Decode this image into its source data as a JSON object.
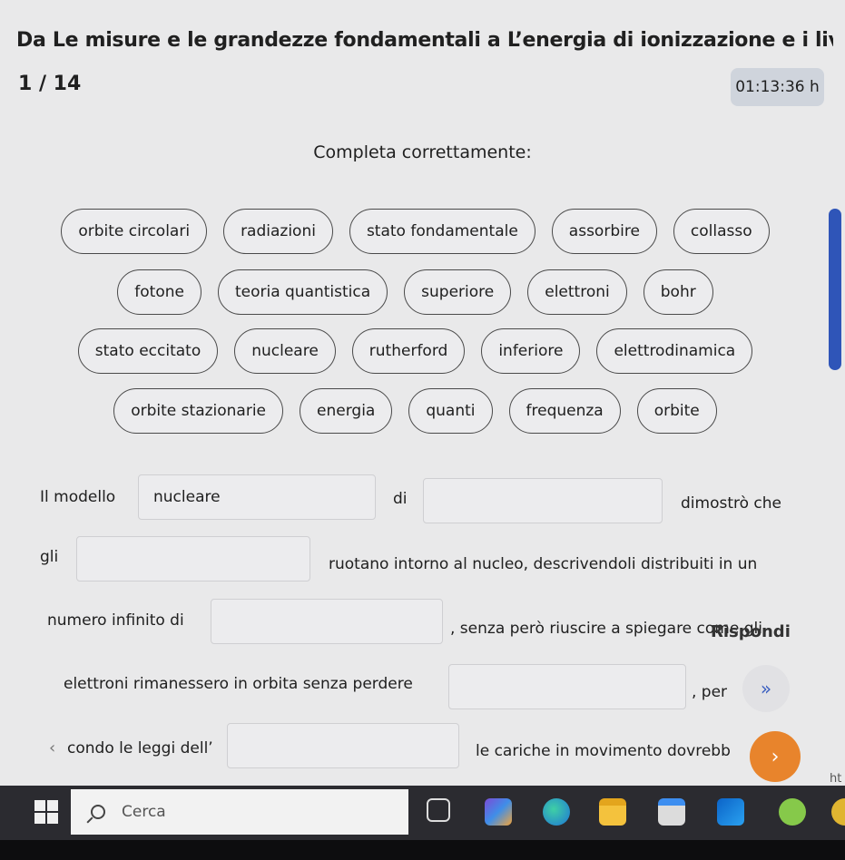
{
  "header": {
    "title": "Da Le misure e le grandezze fondamentali a L’energia di ionizzazione e i livelli en...",
    "counter": "1 / 14",
    "timer": "01:13:36 h"
  },
  "instruction": "Completa correttamente:",
  "chips": [
    [
      "orbite circolari",
      "radiazioni",
      "stato fondamentale",
      "assorbire",
      "collasso"
    ],
    [
      "fotone",
      "teoria quantistica",
      "superiore",
      "elettroni",
      "bohr"
    ],
    [
      "stato eccitato",
      "nucleare",
      "rutherford",
      "inferiore",
      "elettrodinamica"
    ],
    [
      "orbite stazionarie",
      "energia",
      "quanti",
      "frequenza",
      "orbite"
    ]
  ],
  "passage": {
    "t1": "Il modello",
    "b1": "nucleare",
    "t2": "di",
    "b2": "",
    "t3": "dimostrò che",
    "t4": "gli",
    "b3": "",
    "t5": "ruotano intorno al nucleo, descrivendoli distribuiti in un",
    "t6": "numero infinito di",
    "b4": "",
    "t7": ", senza però riuscire a spiegare come gli",
    "t8": "elettroni rimanessero in orbita senza perdere",
    "b5": "",
    "t9": ", per",
    "t10": "condo le leggi dell’",
    "b6": "",
    "t11": "le cariche in movimento dovrebb"
  },
  "controls": {
    "respond": "Rispondi",
    "chevron": "»",
    "next": "›",
    "prev": "‹"
  },
  "edge_fragment": "ht",
  "taskbar": {
    "search_label": "Cerca"
  },
  "colors": {
    "accent": "#2f55b8",
    "next_button": "#e8842c",
    "timer_bg": "#cfd4dc"
  }
}
